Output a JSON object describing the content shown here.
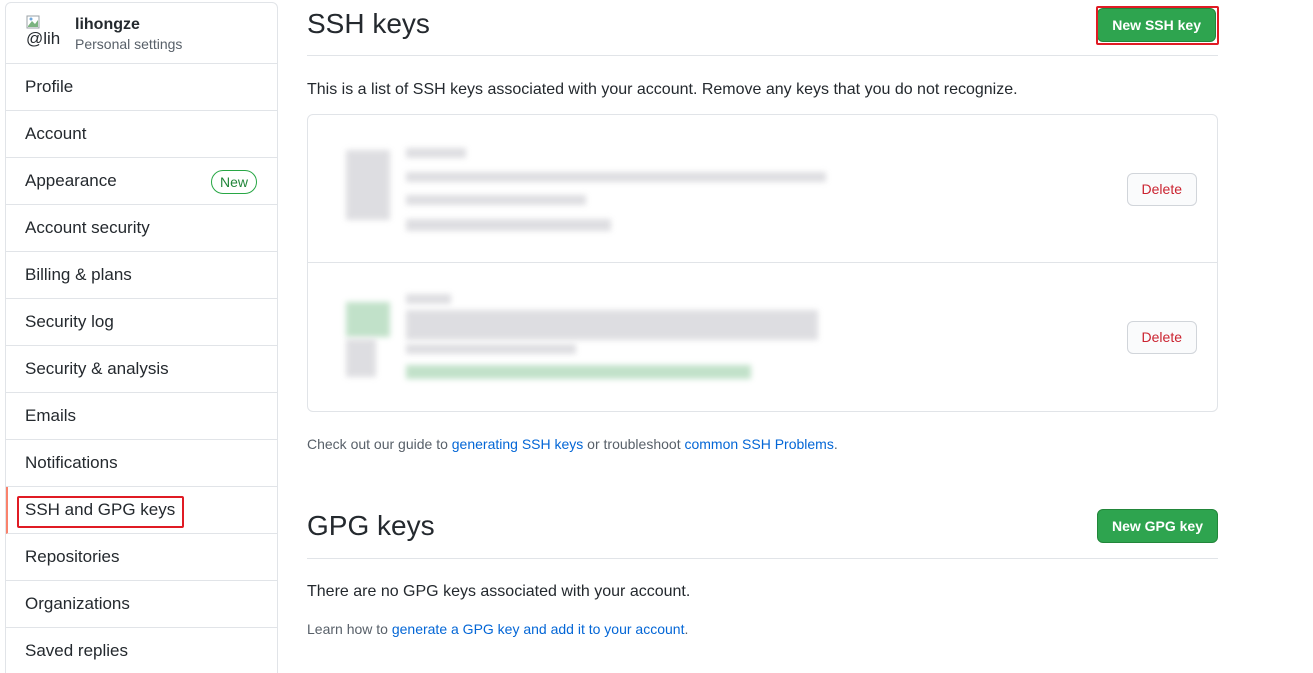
{
  "user": {
    "name": "lihongze",
    "subtitle": "Personal settings",
    "avatar_alt": "@lih"
  },
  "sidebar": {
    "items": [
      {
        "label": "Profile"
      },
      {
        "label": "Account"
      },
      {
        "label": "Appearance",
        "badge": "New"
      },
      {
        "label": "Account security"
      },
      {
        "label": "Billing & plans"
      },
      {
        "label": "Security log"
      },
      {
        "label": "Security & analysis"
      },
      {
        "label": "Emails"
      },
      {
        "label": "Notifications"
      },
      {
        "label": "SSH and GPG keys",
        "selected": true
      },
      {
        "label": "Repositories"
      },
      {
        "label": "Organizations"
      },
      {
        "label": "Saved replies"
      }
    ]
  },
  "ssh": {
    "title": "SSH keys",
    "new_button": "New SSH key",
    "description": "This is a list of SSH keys associated with your account. Remove any keys that you do not recognize.",
    "delete_label": "Delete",
    "footer_prefix": "Check out our guide to ",
    "footer_link1": "generating SSH keys",
    "footer_middle": " or troubleshoot ",
    "footer_link2": "common SSH Problems",
    "footer_suffix": "."
  },
  "gpg": {
    "title": "GPG keys",
    "new_button": "New GPG key",
    "empty_text": "There are no GPG keys associated with your account.",
    "learn_prefix": "Learn how to ",
    "learn_link": "generate a GPG key and add it to your account",
    "learn_suffix": "."
  },
  "colors": {
    "primary": "#2ea44f",
    "danger": "#cb2431",
    "link": "#0366d6",
    "highlight": "#e01b24",
    "selected_border": "#f9826c"
  }
}
